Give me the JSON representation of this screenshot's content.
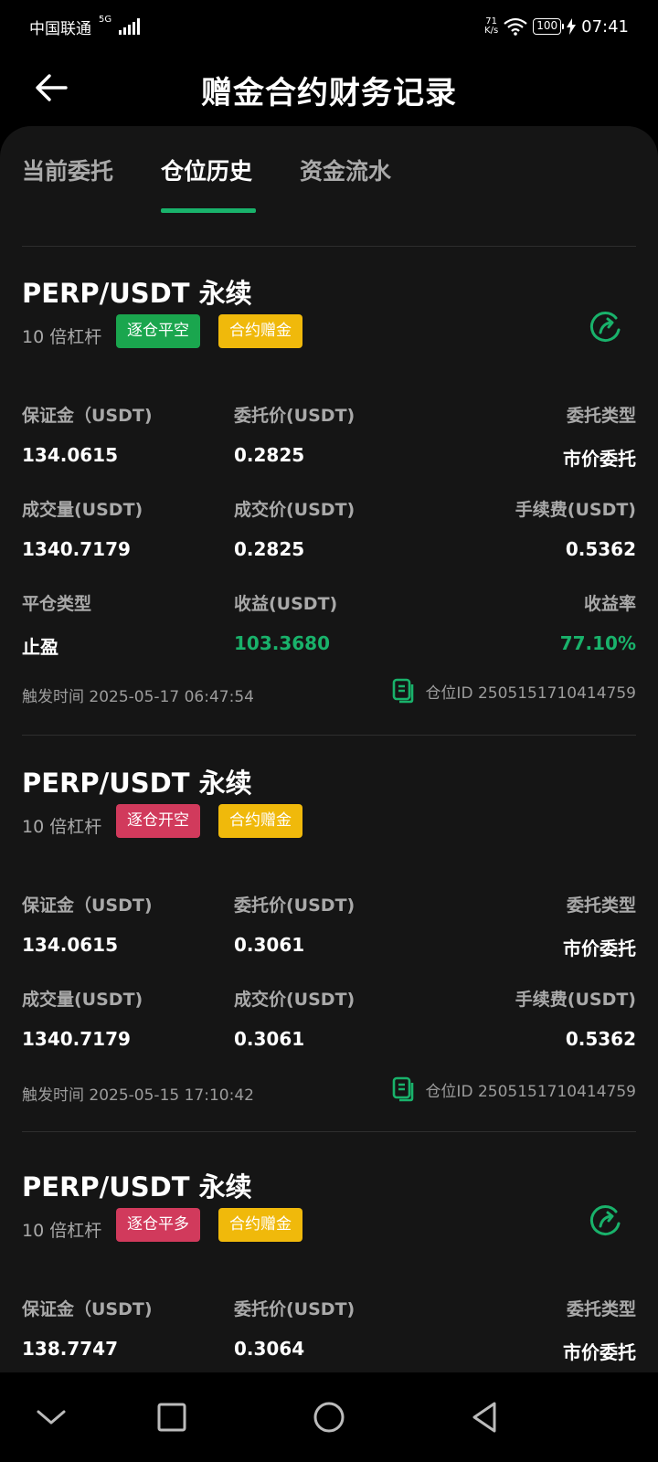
{
  "status_bar": {
    "carrier": "中国联通",
    "network": "5G",
    "speed_value": "71",
    "speed_unit": "K/s",
    "battery": "100",
    "time": "07:41"
  },
  "header": {
    "title": "赠金合约财务记录",
    "back_icon": "arrow-left-icon"
  },
  "tabs": [
    {
      "label": "当前委托",
      "active": false
    },
    {
      "label": "仓位历史",
      "active": true
    },
    {
      "label": "资金流水",
      "active": false
    }
  ],
  "colors": {
    "accent_green": "#19b26b",
    "tag_green": "#1aa64e",
    "tag_red": "#d13a5c",
    "tag_yellow": "#f0b90b",
    "background": "#151515"
  },
  "records": [
    {
      "title": "PERP/USDT 永续",
      "leverage": "10 倍杠杆",
      "tag_direction": "逐仓平空",
      "tag_bonus": "合约赠金",
      "margin_label": "保证金（USDT)",
      "margin_value": "134.0615",
      "order_price_label": "委托价(USDT)",
      "order_price_value": "0.2825",
      "order_type_label": "委托类型",
      "order_type_value": "市价委托",
      "volume_label": "成交量(USDT)",
      "volume_value": "1340.7179",
      "fill_price_label": "成交价(USDT)",
      "fill_price_value": "0.2825",
      "fee_label": "手续费(USDT)",
      "fee_value": "0.5362",
      "close_type_label": "平仓类型",
      "close_type_value": "止盈",
      "pnl_label": "收益(USDT)",
      "pnl_value": "103.3680",
      "roi_label": "收益率",
      "roi_value": "77.10%",
      "trigger_time": "触发时间 2025-05-17 06:47:54",
      "position_id": "仓位ID 2505151710414759"
    },
    {
      "title": "PERP/USDT 永续",
      "leverage": "10 倍杠杆",
      "tag_direction": "逐仓开空",
      "tag_bonus": "合约赠金",
      "margin_label": "保证金（USDT)",
      "margin_value": "134.0615",
      "order_price_label": "委托价(USDT)",
      "order_price_value": "0.3061",
      "order_type_label": "委托类型",
      "order_type_value": "市价委托",
      "volume_label": "成交量(USDT)",
      "volume_value": "1340.7179",
      "fill_price_label": "成交价(USDT)",
      "fill_price_value": "0.3061",
      "fee_label": "手续费(USDT)",
      "fee_value": "0.5362",
      "trigger_time": "触发时间 2025-05-15 17:10:42",
      "position_id": "仓位ID 2505151710414759"
    },
    {
      "title": "PERP/USDT 永续",
      "leverage": "10 倍杠杆",
      "tag_direction": "逐仓平多",
      "tag_bonus": "合约赠金",
      "margin_label": "保证金（USDT)",
      "margin_value": "138.7747",
      "order_price_label": "委托价(USDT)",
      "order_price_value": "0.3064",
      "order_type_label": "委托类型",
      "order_type_value": "市价委托"
    }
  ],
  "nav_bar": {
    "icons": [
      "chevron-down-icon",
      "square-icon",
      "circle-icon",
      "triangle-back-icon"
    ]
  }
}
